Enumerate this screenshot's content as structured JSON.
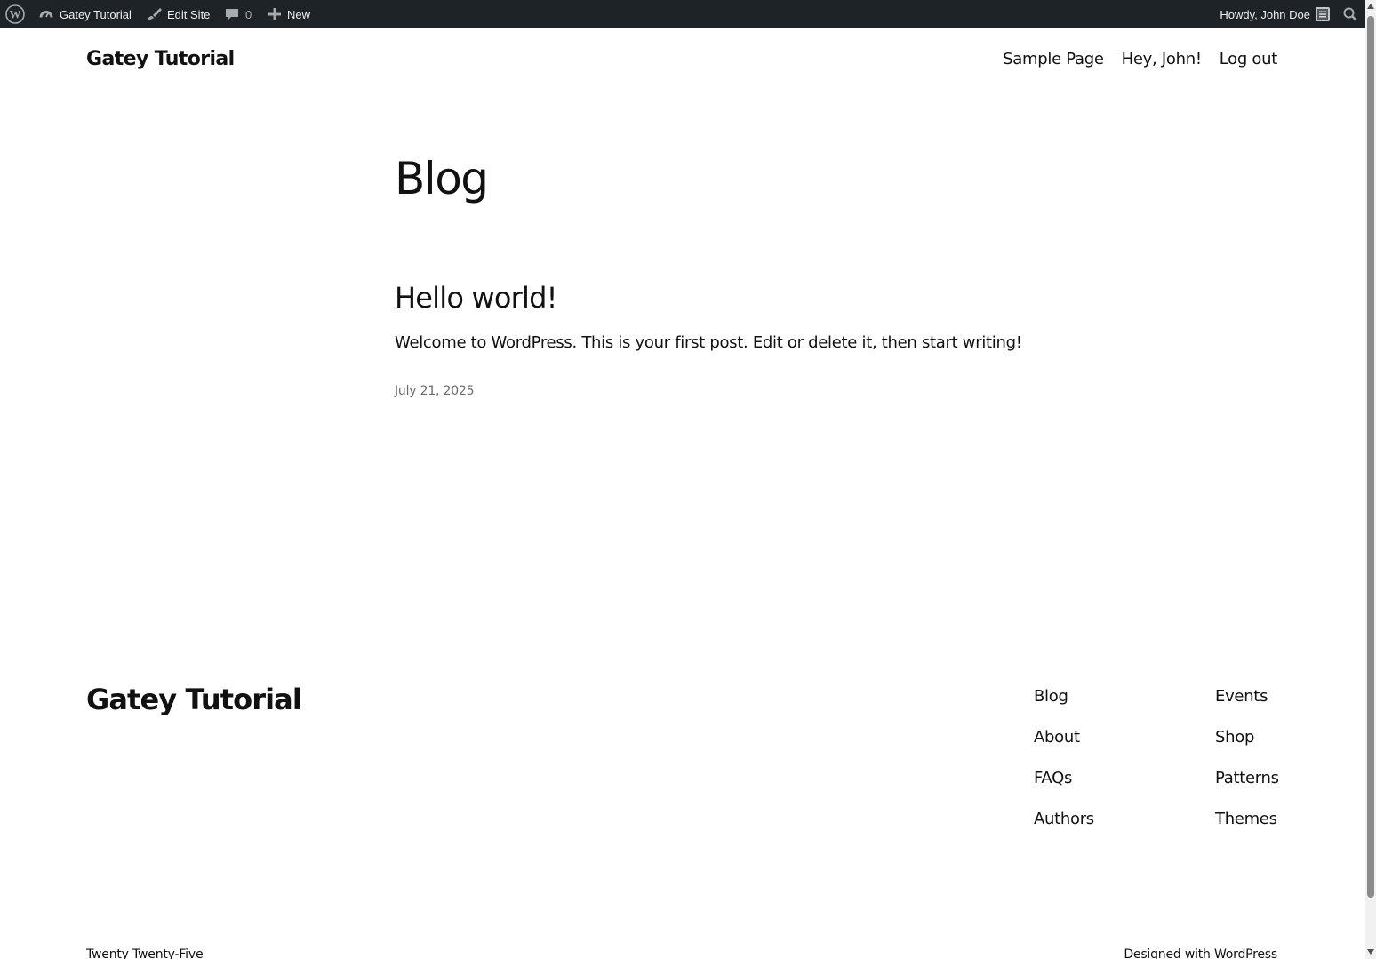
{
  "adminbar": {
    "site_name": "Gatey Tutorial",
    "edit_site": "Edit Site",
    "comments_count": "0",
    "new_label": "New",
    "howdy": "Howdy, John Doe"
  },
  "header": {
    "site_title": "Gatey Tutorial",
    "nav": [
      "Sample Page",
      "Hey, John!",
      "Log out"
    ]
  },
  "main": {
    "heading": "Blog",
    "posts": [
      {
        "title": "Hello world!",
        "excerpt": "Welcome to WordPress. This is your first post. Edit or delete it, then start writing!",
        "date": "July 21, 2025"
      }
    ]
  },
  "footer": {
    "site_title": "Gatey Tutorial",
    "col1": [
      "Blog",
      "About",
      "FAQs",
      "Authors"
    ],
    "col2": [
      "Events",
      "Shop",
      "Patterns",
      "Themes"
    ],
    "theme_name": "Twenty Twenty-Five",
    "designed_with_prefix": "Designed with ",
    "designed_with_link": "WordPress"
  }
}
